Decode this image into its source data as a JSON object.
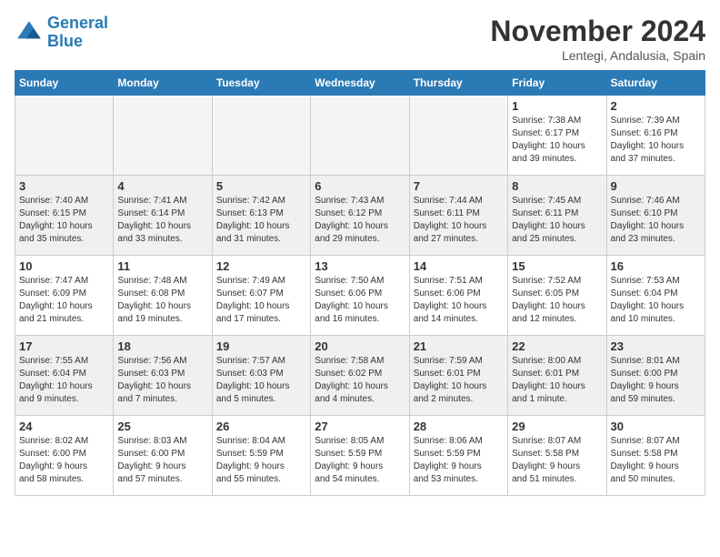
{
  "logo": {
    "line1": "General",
    "line2": "Blue"
  },
  "title": "November 2024",
  "location": "Lentegi, Andalusia, Spain",
  "headers": [
    "Sunday",
    "Monday",
    "Tuesday",
    "Wednesday",
    "Thursday",
    "Friday",
    "Saturday"
  ],
  "weeks": [
    [
      {
        "day": "",
        "info": "",
        "empty": true
      },
      {
        "day": "",
        "info": "",
        "empty": true
      },
      {
        "day": "",
        "info": "",
        "empty": true
      },
      {
        "day": "",
        "info": "",
        "empty": true
      },
      {
        "day": "",
        "info": "",
        "empty": true
      },
      {
        "day": "1",
        "info": "Sunrise: 7:38 AM\nSunset: 6:17 PM\nDaylight: 10 hours\nand 39 minutes.",
        "empty": false
      },
      {
        "day": "2",
        "info": "Sunrise: 7:39 AM\nSunset: 6:16 PM\nDaylight: 10 hours\nand 37 minutes.",
        "empty": false
      }
    ],
    [
      {
        "day": "3",
        "info": "Sunrise: 7:40 AM\nSunset: 6:15 PM\nDaylight: 10 hours\nand 35 minutes.",
        "empty": false
      },
      {
        "day": "4",
        "info": "Sunrise: 7:41 AM\nSunset: 6:14 PM\nDaylight: 10 hours\nand 33 minutes.",
        "empty": false
      },
      {
        "day": "5",
        "info": "Sunrise: 7:42 AM\nSunset: 6:13 PM\nDaylight: 10 hours\nand 31 minutes.",
        "empty": false
      },
      {
        "day": "6",
        "info": "Sunrise: 7:43 AM\nSunset: 6:12 PM\nDaylight: 10 hours\nand 29 minutes.",
        "empty": false
      },
      {
        "day": "7",
        "info": "Sunrise: 7:44 AM\nSunset: 6:11 PM\nDaylight: 10 hours\nand 27 minutes.",
        "empty": false
      },
      {
        "day": "8",
        "info": "Sunrise: 7:45 AM\nSunset: 6:11 PM\nDaylight: 10 hours\nand 25 minutes.",
        "empty": false
      },
      {
        "day": "9",
        "info": "Sunrise: 7:46 AM\nSunset: 6:10 PM\nDaylight: 10 hours\nand 23 minutes.",
        "empty": false
      }
    ],
    [
      {
        "day": "10",
        "info": "Sunrise: 7:47 AM\nSunset: 6:09 PM\nDaylight: 10 hours\nand 21 minutes.",
        "empty": false
      },
      {
        "day": "11",
        "info": "Sunrise: 7:48 AM\nSunset: 6:08 PM\nDaylight: 10 hours\nand 19 minutes.",
        "empty": false
      },
      {
        "day": "12",
        "info": "Sunrise: 7:49 AM\nSunset: 6:07 PM\nDaylight: 10 hours\nand 17 minutes.",
        "empty": false
      },
      {
        "day": "13",
        "info": "Sunrise: 7:50 AM\nSunset: 6:06 PM\nDaylight: 10 hours\nand 16 minutes.",
        "empty": false
      },
      {
        "day": "14",
        "info": "Sunrise: 7:51 AM\nSunset: 6:06 PM\nDaylight: 10 hours\nand 14 minutes.",
        "empty": false
      },
      {
        "day": "15",
        "info": "Sunrise: 7:52 AM\nSunset: 6:05 PM\nDaylight: 10 hours\nand 12 minutes.",
        "empty": false
      },
      {
        "day": "16",
        "info": "Sunrise: 7:53 AM\nSunset: 6:04 PM\nDaylight: 10 hours\nand 10 minutes.",
        "empty": false
      }
    ],
    [
      {
        "day": "17",
        "info": "Sunrise: 7:55 AM\nSunset: 6:04 PM\nDaylight: 10 hours\nand 9 minutes.",
        "empty": false
      },
      {
        "day": "18",
        "info": "Sunrise: 7:56 AM\nSunset: 6:03 PM\nDaylight: 10 hours\nand 7 minutes.",
        "empty": false
      },
      {
        "day": "19",
        "info": "Sunrise: 7:57 AM\nSunset: 6:03 PM\nDaylight: 10 hours\nand 5 minutes.",
        "empty": false
      },
      {
        "day": "20",
        "info": "Sunrise: 7:58 AM\nSunset: 6:02 PM\nDaylight: 10 hours\nand 4 minutes.",
        "empty": false
      },
      {
        "day": "21",
        "info": "Sunrise: 7:59 AM\nSunset: 6:01 PM\nDaylight: 10 hours\nand 2 minutes.",
        "empty": false
      },
      {
        "day": "22",
        "info": "Sunrise: 8:00 AM\nSunset: 6:01 PM\nDaylight: 10 hours\nand 1 minute.",
        "empty": false
      },
      {
        "day": "23",
        "info": "Sunrise: 8:01 AM\nSunset: 6:00 PM\nDaylight: 9 hours\nand 59 minutes.",
        "empty": false
      }
    ],
    [
      {
        "day": "24",
        "info": "Sunrise: 8:02 AM\nSunset: 6:00 PM\nDaylight: 9 hours\nand 58 minutes.",
        "empty": false
      },
      {
        "day": "25",
        "info": "Sunrise: 8:03 AM\nSunset: 6:00 PM\nDaylight: 9 hours\nand 57 minutes.",
        "empty": false
      },
      {
        "day": "26",
        "info": "Sunrise: 8:04 AM\nSunset: 5:59 PM\nDaylight: 9 hours\nand 55 minutes.",
        "empty": false
      },
      {
        "day": "27",
        "info": "Sunrise: 8:05 AM\nSunset: 5:59 PM\nDaylight: 9 hours\nand 54 minutes.",
        "empty": false
      },
      {
        "day": "28",
        "info": "Sunrise: 8:06 AM\nSunset: 5:59 PM\nDaylight: 9 hours\nand 53 minutes.",
        "empty": false
      },
      {
        "day": "29",
        "info": "Sunrise: 8:07 AM\nSunset: 5:58 PM\nDaylight: 9 hours\nand 51 minutes.",
        "empty": false
      },
      {
        "day": "30",
        "info": "Sunrise: 8:07 AM\nSunset: 5:58 PM\nDaylight: 9 hours\nand 50 minutes.",
        "empty": false
      }
    ]
  ]
}
